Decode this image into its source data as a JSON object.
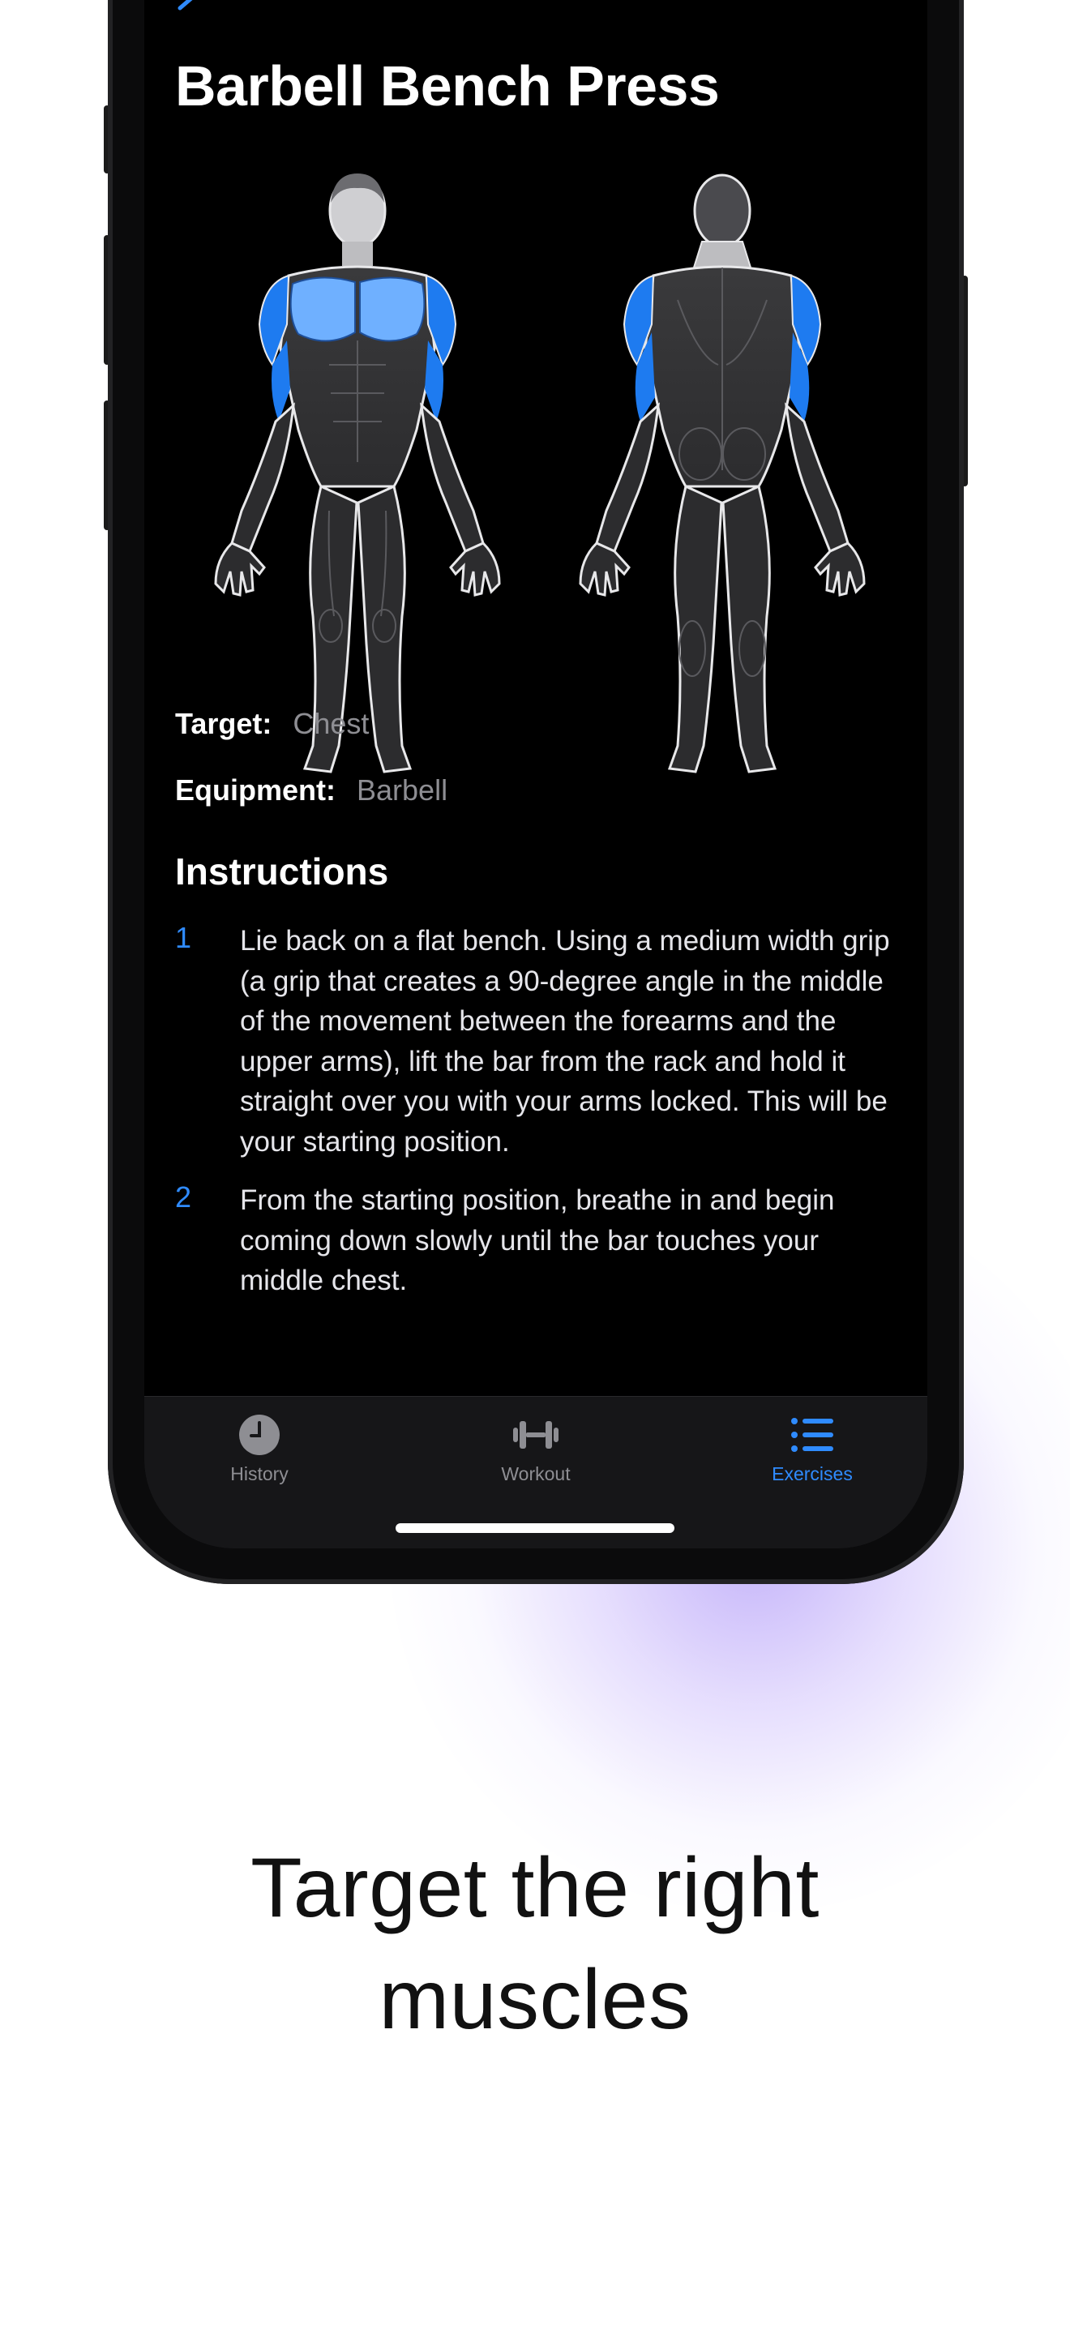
{
  "exercise": {
    "title": "Barbell Bench Press",
    "target_label": "Target:",
    "target_value": "Chest",
    "equipment_label": "Equipment:",
    "equipment_value": "Barbell"
  },
  "instructions": {
    "heading": "Instructions",
    "steps": [
      {
        "number": "1",
        "text": "Lie back on a flat bench. Using a medium width grip (a grip that creates a 90-degree angle in the middle of the movement between the forearms and the upper arms), lift the bar from the rack and hold it straight over you with your arms locked. This will be your starting position."
      },
      {
        "number": "2",
        "text": "From the starting position, breathe in and begin coming down slowly until the bar touches your middle chest."
      }
    ]
  },
  "tabs": [
    {
      "label": "History",
      "icon": "clock-icon",
      "active": false
    },
    {
      "label": "Workout",
      "icon": "dumbbell-icon",
      "active": false
    },
    {
      "label": "Exercises",
      "icon": "list-icon",
      "active": true
    }
  ],
  "marketing": {
    "headline_line1": "Target the right",
    "headline_line2": "muscles"
  },
  "colors": {
    "accent": "#2f8bff",
    "highlight_muscle": "#1e7bf0",
    "highlight_chest": "#6fb0ff",
    "glow": "#9f86f5"
  }
}
